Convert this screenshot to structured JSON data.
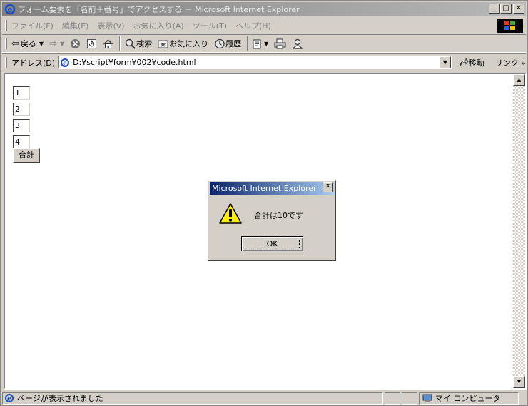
{
  "window": {
    "title": "フォーム要素を「名前＋番号」でアクセスする － Microsoft Internet Explorer",
    "minimize": "_",
    "maximize": "□",
    "close": "✕"
  },
  "menu": {
    "items": [
      "ファイル(F)",
      "編集(E)",
      "表示(V)",
      "お気に入り(A)",
      "ツール(T)",
      "ヘルプ(H)"
    ]
  },
  "toolbar": {
    "back": "戻る",
    "search": "検索",
    "favorites": "お気に入り",
    "history": "履歴"
  },
  "address": {
    "label": "アドレス(D)",
    "url": "D:¥script¥form¥002¥code.html",
    "go": "移動",
    "links": "リンク »"
  },
  "form": {
    "fields": [
      "1",
      "2",
      "3",
      "4"
    ],
    "sum_button": "合計"
  },
  "dialog": {
    "title": "Microsoft Internet Explorer",
    "message": "合計は10です",
    "ok": "OK"
  },
  "status": {
    "text": "ページが表示されました",
    "zone": "マイ コンピュータ"
  },
  "colors": {
    "dialog_title_start": "#0a246a",
    "dialog_title_end": "#a6caf0",
    "chrome": "#d4d0c8"
  }
}
